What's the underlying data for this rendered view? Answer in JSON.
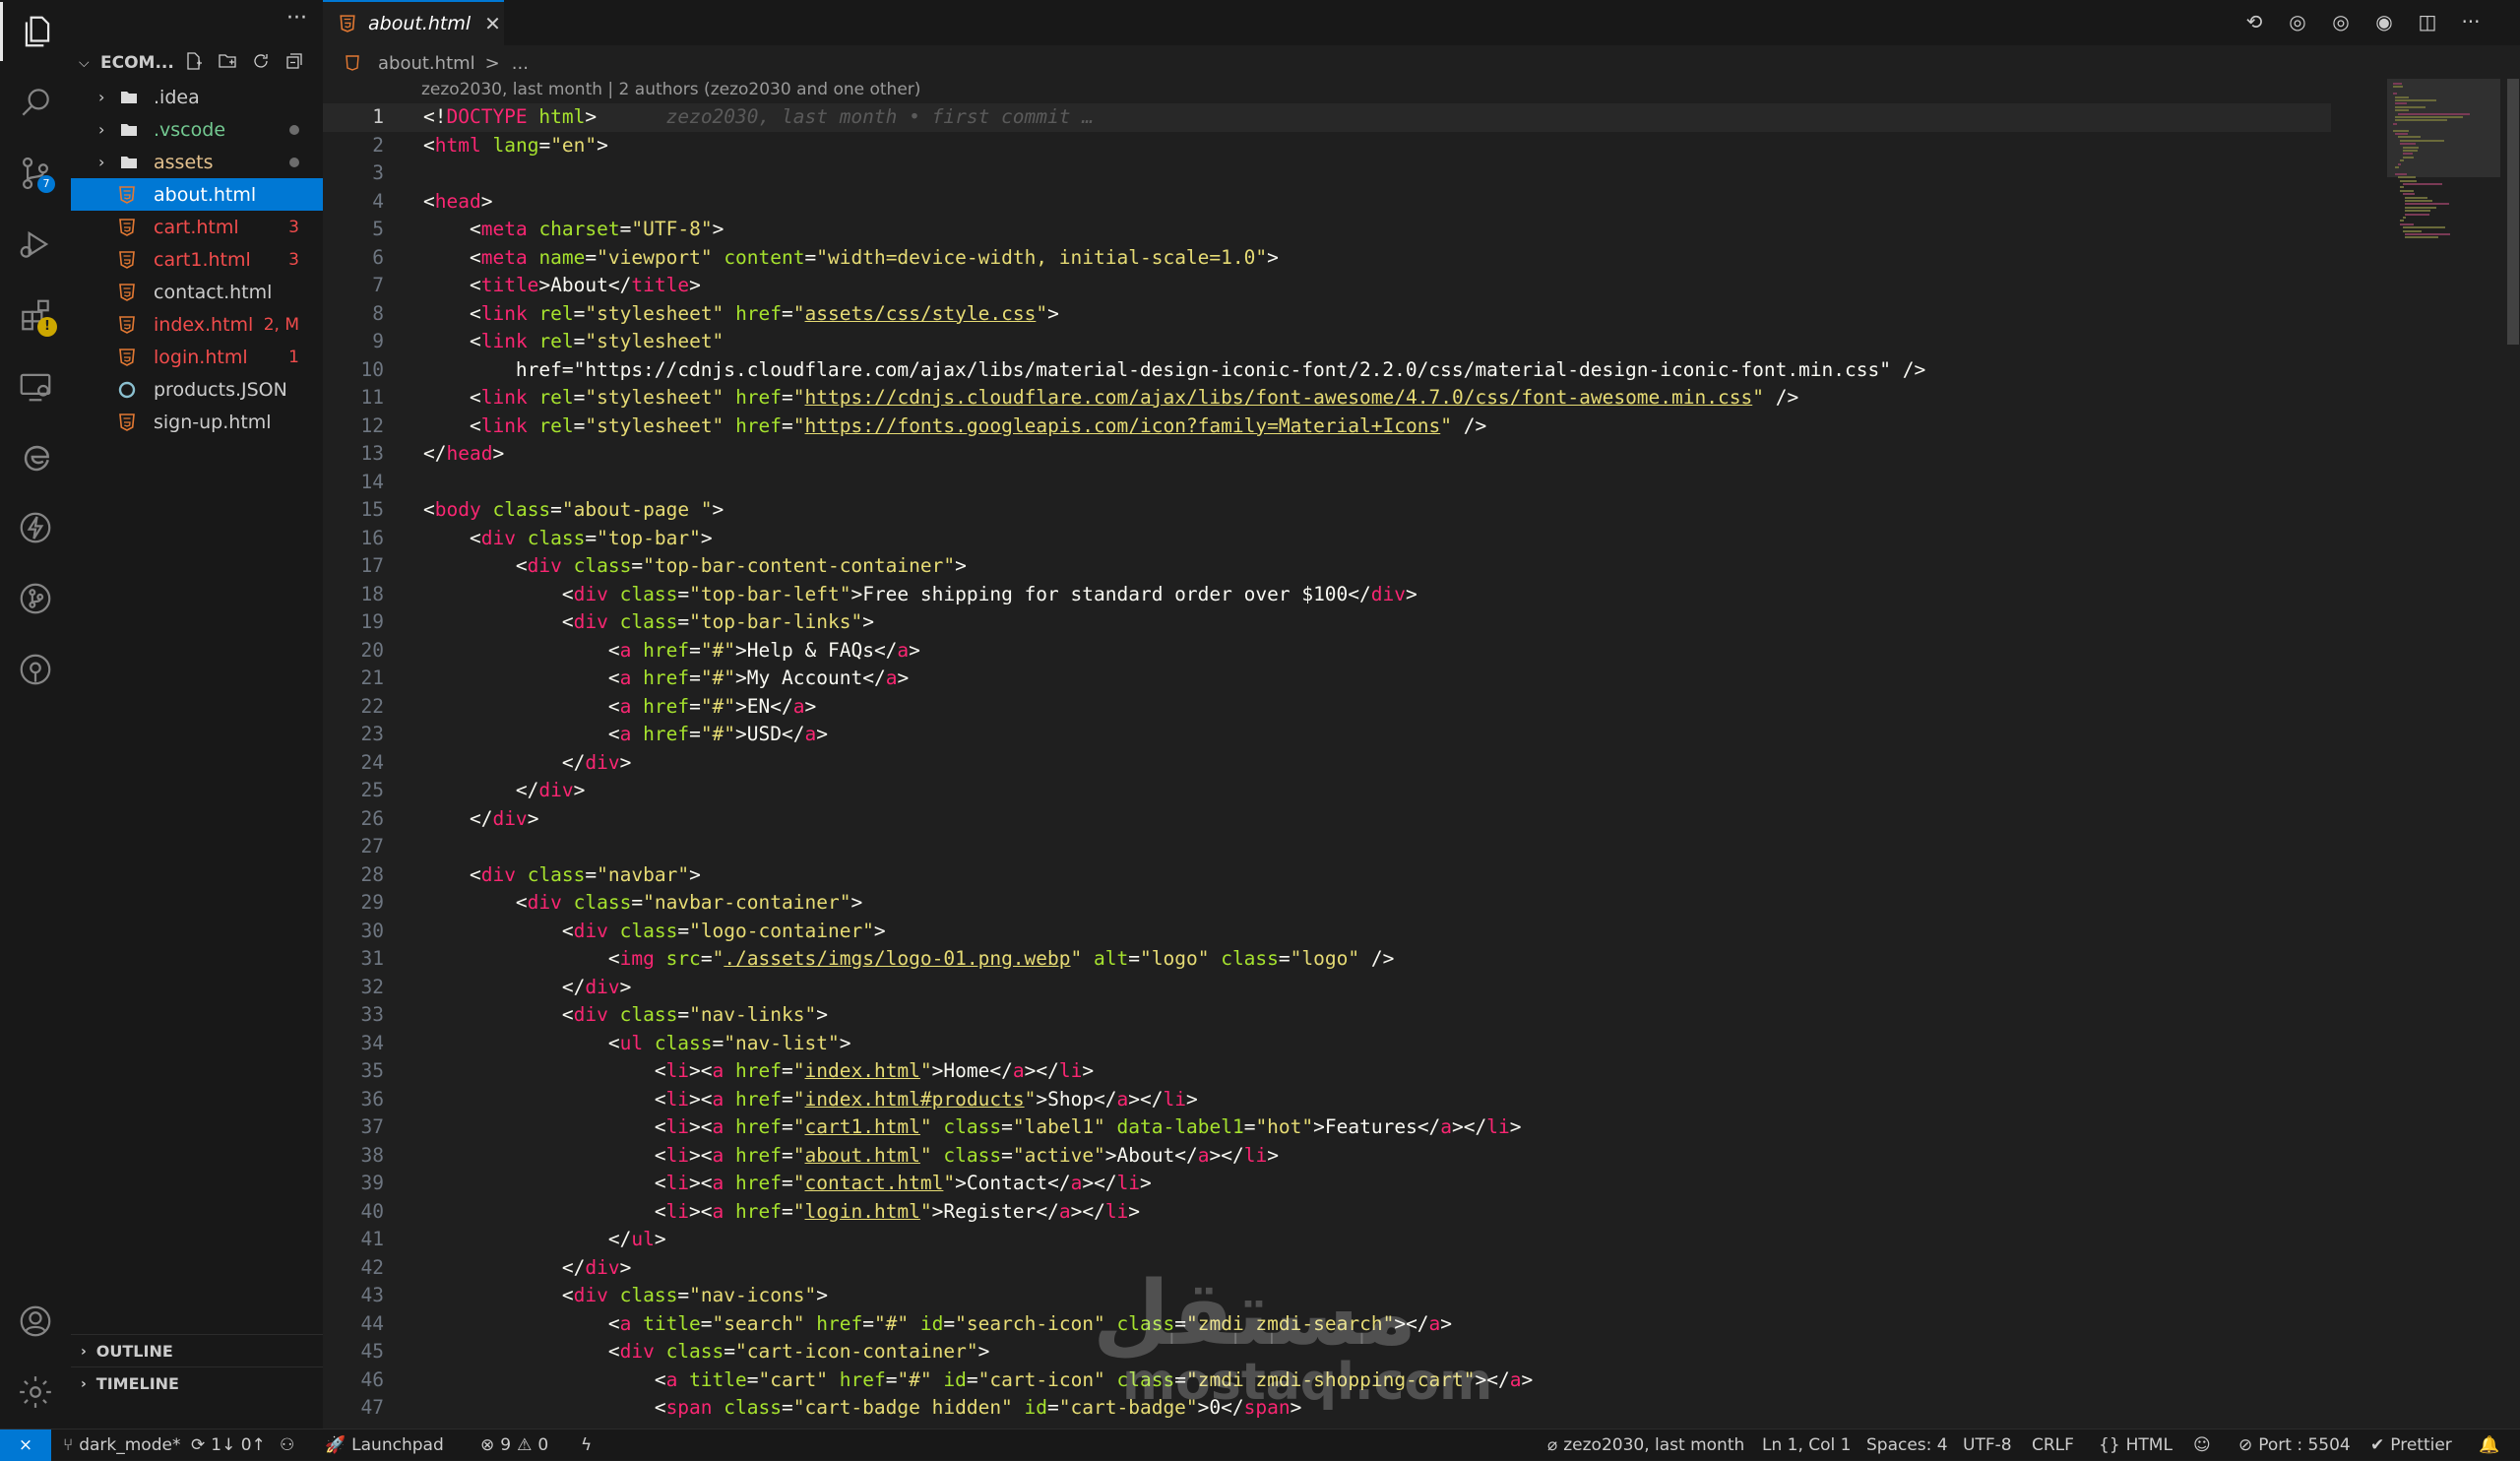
{
  "sidebar": {
    "project_title": "ECOM...",
    "more_label": "···",
    "files": [
      {
        "name": ".idea",
        "type": "folder",
        "color": "#cccccc",
        "badge": "",
        "dot": false
      },
      {
        "name": ".vscode",
        "type": "folder",
        "color": "#73c991",
        "badge": "",
        "dot": true
      },
      {
        "name": "assets",
        "type": "folder",
        "color": "#e2c08d",
        "badge": "",
        "dot": true
      },
      {
        "name": "about.html",
        "type": "html",
        "color": "#ffffff",
        "badge": "",
        "selected": true
      },
      {
        "name": "cart.html",
        "type": "html",
        "color": "#f14c4c",
        "badge": "3"
      },
      {
        "name": "cart1.html",
        "type": "html",
        "color": "#f14c4c",
        "badge": "3"
      },
      {
        "name": "contact.html",
        "type": "html",
        "color": "#cccccc",
        "badge": ""
      },
      {
        "name": "index.html",
        "type": "html",
        "color": "#f14c4c",
        "badge": "2, M"
      },
      {
        "name": "login.html",
        "type": "html",
        "color": "#f14c4c",
        "badge": "1"
      },
      {
        "name": "products.JSON",
        "type": "json",
        "color": "#cccccc",
        "badge": ""
      },
      {
        "name": "sign-up.html",
        "type": "html",
        "color": "#cccccc",
        "badge": ""
      }
    ],
    "outline_label": "OUTLINE",
    "timeline_label": "TIMELINE"
  },
  "activity": {
    "scm_badge": "7",
    "ext_warn": "!"
  },
  "tab": {
    "label": "about.html",
    "close": "✕"
  },
  "breadcrumb": {
    "file": "about.html",
    "sep": ">",
    "more": "..."
  },
  "codelens": "zezo2030, last month | 2 authors (zezo2030 and one other)",
  "blame": "zezo2030, last month • first commit …",
  "code_lines": [
    "<!DOCTYPE html>",
    "<html lang=\"en\">",
    "",
    "<head>",
    "    <meta charset=\"UTF-8\">",
    "    <meta name=\"viewport\" content=\"width=device-width, initial-scale=1.0\">",
    "    <title>About</title>",
    "    <link rel=\"stylesheet\" href=\"assets/css/style.css\">",
    "    <link rel=\"stylesheet\"",
    "        href=\"https://cdnjs.cloudflare.com/ajax/libs/material-design-iconic-font/2.2.0/css/material-design-iconic-font.min.css\" />",
    "    <link rel=\"stylesheet\" href=\"https://cdnjs.cloudflare.com/ajax/libs/font-awesome/4.7.0/css/font-awesome.min.css\" />",
    "    <link rel=\"stylesheet\" href=\"https://fonts.googleapis.com/icon?family=Material+Icons\" />",
    "</head>",
    "",
    "<body class=\"about-page \">",
    "    <div class=\"top-bar\">",
    "        <div class=\"top-bar-content-container\">",
    "            <div class=\"top-bar-left\">Free shipping for standard order over $100</div>",
    "            <div class=\"top-bar-links\">",
    "                <a href=\"#\">Help & FAQs</a>",
    "                <a href=\"#\">My Account</a>",
    "                <a href=\"#\">EN</a>",
    "                <a href=\"#\">USD</a>",
    "            </div>",
    "        </div>",
    "    </div>",
    "",
    "    <div class=\"navbar\">",
    "        <div class=\"navbar-container\">",
    "            <div class=\"logo-container\">",
    "                <img src=\"./assets/imgs/logo-01.png.webp\" alt=\"logo\" class=\"logo\" />",
    "            </div>",
    "            <div class=\"nav-links\">",
    "                <ul class=\"nav-list\">",
    "                    <li><a href=\"index.html\">Home</a></li>",
    "                    <li><a href=\"index.html#products\">Shop</a></li>",
    "                    <li><a href=\"cart1.html\" class=\"label1\" data-label1=\"hot\">Features</a></li>",
    "                    <li><a href=\"about.html\" class=\"active\">About</a></li>",
    "                    <li><a href=\"contact.html\">Contact</a></li>",
    "                    <li><a href=\"login.html\">Register</a></li>",
    "                </ul>",
    "            </div>",
    "            <div class=\"nav-icons\">",
    "                <a title=\"search\" href=\"#\" id=\"search-icon\" class=\"zmdi zmdi-search\"></a>",
    "                <div class=\"cart-icon-container\">",
    "                    <a title=\"cart\" href=\"#\" id=\"cart-icon\" class=\"zmdi zmdi-shopping-cart\"></a>",
    "                    <span class=\"cart-badge hidden\" id=\"cart-badge\">0</span>"
  ],
  "statusbar": {
    "branch": "dark_mode*",
    "sync": "1↓ 0↑",
    "launchpad": "Launchpad",
    "errors": "9",
    "warnings": "0",
    "blame": "zezo2030, last month",
    "position": "Ln 1, Col 1",
    "spaces": "Spaces: 4",
    "encoding": "UTF-8",
    "eol": "CRLF",
    "language": "HTML",
    "port": "Port : 5504",
    "prettier": "Prettier"
  },
  "watermark": {
    "arabic": "مستقل",
    "latin": "mostaql.com"
  }
}
